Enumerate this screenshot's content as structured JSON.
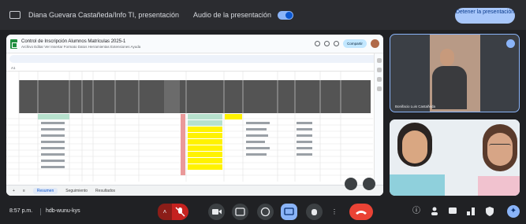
{
  "topbar": {
    "title": "Diana Guevara Castañeda/Info TI, presentación",
    "audio_label": "Audio de la presentación",
    "stop_button": "Detener la presentación"
  },
  "spreadsheet": {
    "doc_title": "Control de Inscripción Alumnos Matrículas 2025-1",
    "menu": "Archivo  Editar  Ver  Insertar  Formato  Datos  Herramientas  Extensiones  Ayuda",
    "share_label": "Compartir",
    "formula_ref": "A1",
    "tabs": [
      "+",
      "≡",
      "Resumen",
      "Seguimiento",
      "Resultados"
    ]
  },
  "participants": [
    {
      "name": "Bonifacio Luis Castañeda"
    },
    {
      "name": ""
    }
  ],
  "bottombar": {
    "time": "8:57 p.m.",
    "meeting_code": "hdb-wunu-kys"
  },
  "icons": {
    "mic": "mic-off-icon",
    "camera": "camera-icon",
    "captions": "captions-icon",
    "emoji": "emoji-icon",
    "present": "present-icon",
    "hand": "raise-hand-icon",
    "more": "more-options-icon",
    "end": "end-call-icon",
    "info": "info-icon",
    "people": "people-icon",
    "chat": "chat-icon",
    "activities": "activities-icon",
    "host": "host-controls-icon",
    "assistant": "assistant-icon"
  },
  "colors": {
    "accent": "#8ab4f8",
    "end_call": "#ea4335",
    "header_band": "#545454",
    "highlight_yellow": "#fff200",
    "highlight_green": "#b7e1cd"
  }
}
